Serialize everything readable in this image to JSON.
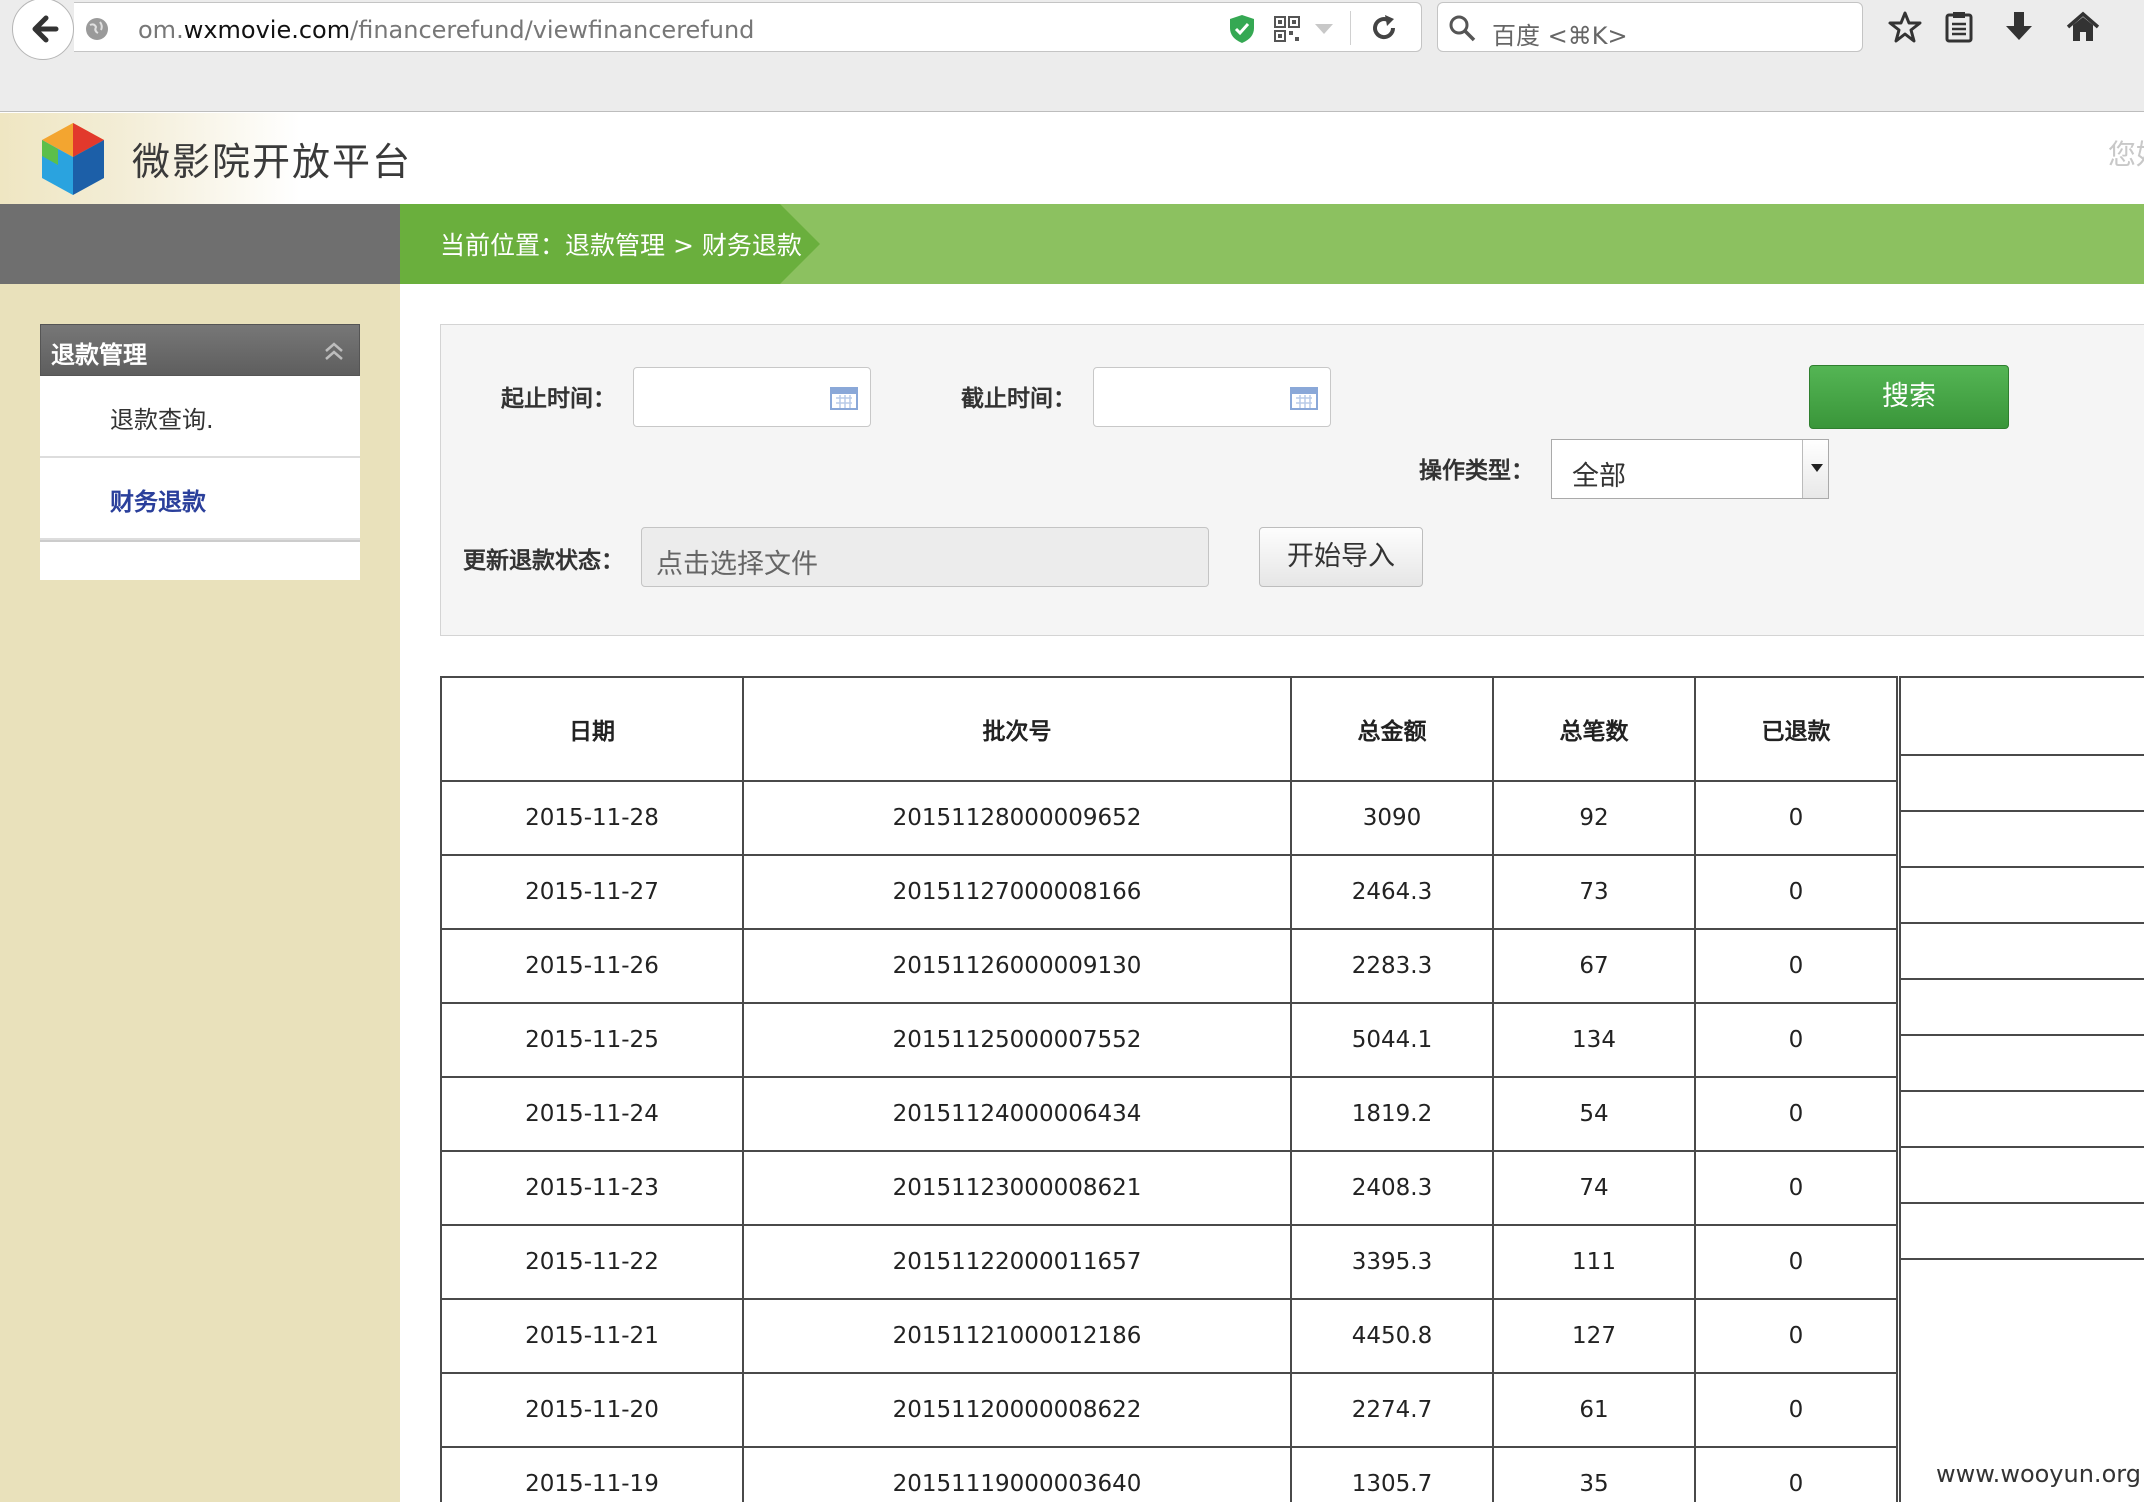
{
  "browser": {
    "url_prefix": "om.",
    "url_domain": "wxmovie.com",
    "url_path": "/financerefund/viewfinancerefund",
    "search_placeholder": "百度 <⌘K>"
  },
  "header": {
    "site_title": "微影院开放平台",
    "greeting": "您好"
  },
  "breadcrumb": "当前位置：退款管理 > 财务退款",
  "sidebar": {
    "section_title": "退款管理",
    "items": [
      {
        "label": "退款查询."
      },
      {
        "label": "财务退款",
        "active": true
      }
    ]
  },
  "filters": {
    "start_label": "起止时间：",
    "end_label": "截止时间：",
    "search_button": "搜索",
    "op_type_label": "操作类型：",
    "op_type_value": "全部",
    "update_label": "更新退款状态：",
    "file_placeholder": "点击选择文件",
    "import_button": "开始导入"
  },
  "table": {
    "headers": [
      "日期",
      "批次号",
      "总金额",
      "总笔数",
      "已退款"
    ],
    "rows": [
      [
        "2015-11-28",
        "20151128000009652",
        "3090",
        "92",
        "0"
      ],
      [
        "2015-11-27",
        "20151127000008166",
        "2464.3",
        "73",
        "0"
      ],
      [
        "2015-11-26",
        "20151126000009130",
        "2283.3",
        "67",
        "0"
      ],
      [
        "2015-11-25",
        "20151125000007552",
        "5044.1",
        "134",
        "0"
      ],
      [
        "2015-11-24",
        "20151124000006434",
        "1819.2",
        "54",
        "0"
      ],
      [
        "2015-11-23",
        "20151123000008621",
        "2408.3",
        "74",
        "0"
      ],
      [
        "2015-11-22",
        "20151122000011657",
        "3395.3",
        "111",
        "0"
      ],
      [
        "2015-11-21",
        "20151121000012186",
        "4450.8",
        "127",
        "0"
      ],
      [
        "2015-11-20",
        "20151120000008622",
        "2274.7",
        "61",
        "0"
      ],
      [
        "2015-11-19",
        "20151119000003640",
        "1305.7",
        "35",
        "0"
      ]
    ]
  },
  "watermark": "www.wooyun.org",
  "colors": {
    "green_band": "#8cc160",
    "breadcrumb_green": "#6aaf3d",
    "sidebar_bg": "#e9e1bb",
    "search_btn": "#3a963a",
    "active_link": "#2a3f9b"
  },
  "icons": [
    "back-arrow-icon",
    "globe-icon",
    "shield-check-icon",
    "qr-code-icon",
    "reload-icon",
    "search-icon",
    "star-icon",
    "reading-list-icon",
    "download-icon",
    "home-icon",
    "calendar-icon",
    "chevron-up-icon",
    "logo-cube-icon"
  ]
}
